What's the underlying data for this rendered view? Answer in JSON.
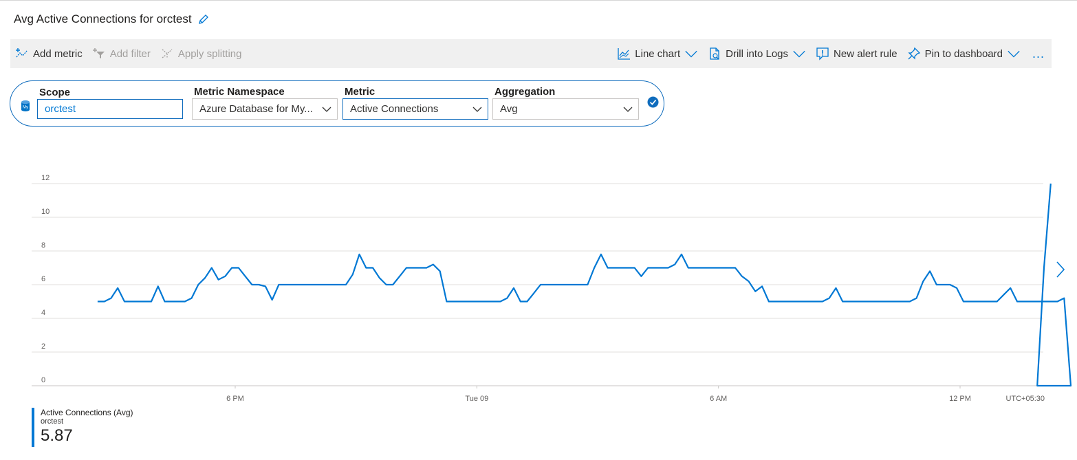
{
  "header": {
    "title": "Avg Active Connections for orctest"
  },
  "toolbar": {
    "add_metric": "Add metric",
    "add_filter": "Add filter",
    "apply_splitting": "Apply splitting",
    "line_chart": "Line chart",
    "drill_logs": "Drill into Logs",
    "new_alert": "New alert rule",
    "pin": "Pin to dashboard",
    "more": "..."
  },
  "selector": {
    "scope_label": "Scope",
    "scope_value": "orctest",
    "namespace_label": "Metric Namespace",
    "namespace_value": "Azure Database for My...",
    "metric_label": "Metric",
    "metric_value": "Active Connections",
    "aggregation_label": "Aggregation",
    "aggregation_value": "Avg"
  },
  "chart_data": {
    "type": "line",
    "ylim": [
      0,
      12
    ],
    "y_ticks": [
      "0",
      "2",
      "4",
      "6",
      "8",
      "10",
      "12"
    ],
    "x_ticks": [
      "6 PM",
      "Tue 09",
      "6 AM",
      "12 PM"
    ],
    "timezone_label": "UTC+05:30",
    "grid": true,
    "series": [
      {
        "name": "Active Connections (Avg)",
        "resource": "orctest",
        "color": "#0078d4",
        "points": [
          [
            "14:35",
            5
          ],
          [
            "14:45",
            5
          ],
          [
            "14:55",
            5.2
          ],
          [
            "15:05",
            5.8
          ],
          [
            "15:15",
            5
          ],
          [
            "15:25",
            5
          ],
          [
            "15:35",
            5
          ],
          [
            "15:45",
            5
          ],
          [
            "15:55",
            5
          ],
          [
            "16:05",
            5.9
          ],
          [
            "16:15",
            5
          ],
          [
            "16:25",
            5
          ],
          [
            "16:35",
            5
          ],
          [
            "16:45",
            5
          ],
          [
            "16:55",
            5.2
          ],
          [
            "17:05",
            6
          ],
          [
            "17:15",
            6.4
          ],
          [
            "17:25",
            7
          ],
          [
            "17:35",
            6.3
          ],
          [
            "17:45",
            6.5
          ],
          [
            "17:55",
            7
          ],
          [
            "18:05",
            7
          ],
          [
            "18:15",
            6.5
          ],
          [
            "18:25",
            6
          ],
          [
            "18:35",
            6
          ],
          [
            "18:45",
            5.9
          ],
          [
            "18:55",
            5.1
          ],
          [
            "19:05",
            6
          ],
          [
            "19:15",
            6
          ],
          [
            "19:25",
            6
          ],
          [
            "19:35",
            6
          ],
          [
            "19:45",
            6
          ],
          [
            "19:55",
            6
          ],
          [
            "20:05",
            6
          ],
          [
            "20:15",
            6
          ],
          [
            "20:25",
            6
          ],
          [
            "20:35",
            6
          ],
          [
            "20:45",
            6
          ],
          [
            "20:55",
            6.6
          ],
          [
            "21:05",
            7.8
          ],
          [
            "21:15",
            7
          ],
          [
            "21:25",
            7
          ],
          [
            "21:35",
            6.4
          ],
          [
            "21:45",
            6
          ],
          [
            "21:55",
            6
          ],
          [
            "22:05",
            6.5
          ],
          [
            "22:15",
            7
          ],
          [
            "22:25",
            7
          ],
          [
            "22:35",
            7
          ],
          [
            "22:45",
            7
          ],
          [
            "22:55",
            7.2
          ],
          [
            "23:05",
            6.8
          ],
          [
            "23:15",
            5
          ],
          [
            "23:25",
            5
          ],
          [
            "23:35",
            5
          ],
          [
            "23:45",
            5
          ],
          [
            "23:55",
            5
          ],
          [
            "00:05",
            5
          ],
          [
            "00:15",
            5
          ],
          [
            "00:25",
            5
          ],
          [
            "00:35",
            5
          ],
          [
            "00:45",
            5.2
          ],
          [
            "00:55",
            5.8
          ],
          [
            "01:05",
            5
          ],
          [
            "01:15",
            5
          ],
          [
            "01:25",
            5.5
          ],
          [
            "01:35",
            6
          ],
          [
            "01:45",
            6
          ],
          [
            "01:55",
            6
          ],
          [
            "02:05",
            6
          ],
          [
            "02:15",
            6
          ],
          [
            "02:25",
            6
          ],
          [
            "02:35",
            6
          ],
          [
            "02:45",
            6
          ],
          [
            "02:55",
            7
          ],
          [
            "03:05",
            7.8
          ],
          [
            "03:15",
            7
          ],
          [
            "03:25",
            7
          ],
          [
            "03:35",
            7
          ],
          [
            "03:45",
            7
          ],
          [
            "03:55",
            7
          ],
          [
            "04:05",
            6.5
          ],
          [
            "04:15",
            7
          ],
          [
            "04:25",
            7
          ],
          [
            "04:35",
            7
          ],
          [
            "04:45",
            7
          ],
          [
            "04:55",
            7.2
          ],
          [
            "05:05",
            7.8
          ],
          [
            "05:15",
            7
          ],
          [
            "05:25",
            7
          ],
          [
            "05:35",
            7
          ],
          [
            "05:45",
            7
          ],
          [
            "05:55",
            7
          ],
          [
            "06:05",
            7
          ],
          [
            "06:15",
            7
          ],
          [
            "06:25",
            7
          ],
          [
            "06:35",
            6.5
          ],
          [
            "06:45",
            6.2
          ],
          [
            "06:55",
            5.6
          ],
          [
            "07:05",
            5.9
          ],
          [
            "07:15",
            5
          ],
          [
            "07:25",
            5
          ],
          [
            "07:35",
            5
          ],
          [
            "07:45",
            5
          ],
          [
            "07:55",
            5
          ],
          [
            "08:05",
            5
          ],
          [
            "08:15",
            5
          ],
          [
            "08:25",
            5
          ],
          [
            "08:35",
            5
          ],
          [
            "08:45",
            5.2
          ],
          [
            "08:55",
            5.8
          ],
          [
            "09:05",
            5
          ],
          [
            "09:15",
            5
          ],
          [
            "09:25",
            5
          ],
          [
            "09:35",
            5
          ],
          [
            "09:45",
            5
          ],
          [
            "09:55",
            5
          ],
          [
            "10:05",
            5
          ],
          [
            "10:15",
            5
          ],
          [
            "10:25",
            5
          ],
          [
            "10:35",
            5
          ],
          [
            "10:45",
            5
          ],
          [
            "10:55",
            5.2
          ],
          [
            "11:05",
            6.2
          ],
          [
            "11:15",
            6.8
          ],
          [
            "11:25",
            6
          ],
          [
            "11:35",
            6
          ],
          [
            "11:45",
            6
          ],
          [
            "11:55",
            5.8
          ],
          [
            "12:05",
            5
          ],
          [
            "12:15",
            5
          ],
          [
            "12:25",
            5
          ],
          [
            "12:35",
            5
          ],
          [
            "12:45",
            5
          ],
          [
            "12:55",
            5
          ],
          [
            "13:05",
            5.4
          ],
          [
            "13:15",
            5.8
          ],
          [
            "13:25",
            5
          ],
          [
            "13:35",
            5
          ],
          [
            "13:45",
            5
          ],
          [
            "13:55",
            5
          ],
          [
            "14:05",
            5
          ],
          [
            "14:15",
            5
          ],
          [
            "14:25",
            5
          ],
          [
            "14:35",
            5.2
          ],
          [
            "14:45",
            0
          ],
          [
            "13:55+1",
            0
          ],
          [
            "14:05+1",
            7
          ],
          [
            "14:15+1",
            12
          ]
        ]
      }
    ],
    "legend_value": "5.87"
  }
}
